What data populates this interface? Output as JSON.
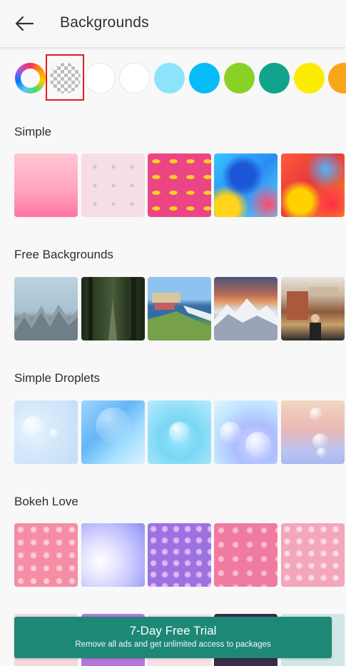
{
  "header": {
    "title": "Backgrounds",
    "back_icon": "arrow-left-icon"
  },
  "swatches": [
    {
      "name": "color-picker",
      "color": "rainbow"
    },
    {
      "name": "transparent",
      "color": "checkerboard",
      "selected": true
    },
    {
      "name": "white-1",
      "color": "#ffffff"
    },
    {
      "name": "white-2",
      "color": "#ffffff"
    },
    {
      "name": "light-blue",
      "color": "#8de3fb"
    },
    {
      "name": "sky-blue",
      "color": "#06bdf7"
    },
    {
      "name": "green",
      "color": "#8ad125"
    },
    {
      "name": "teal",
      "color": "#11a48a"
    },
    {
      "name": "yellow",
      "color": "#fcec00"
    },
    {
      "name": "orange",
      "color": "#f9a51a"
    }
  ],
  "sections": [
    {
      "title": "Simple"
    },
    {
      "title": "Free Backgrounds"
    },
    {
      "title": "Simple Droplets"
    },
    {
      "title": "Bokeh Love"
    }
  ],
  "trial": {
    "title": "7-Day Free Trial",
    "subtitle": "Remove all ads and get unlimited access to packages"
  },
  "colors": {
    "accent": "#1e8876",
    "selected_border": "#e21d1d"
  }
}
